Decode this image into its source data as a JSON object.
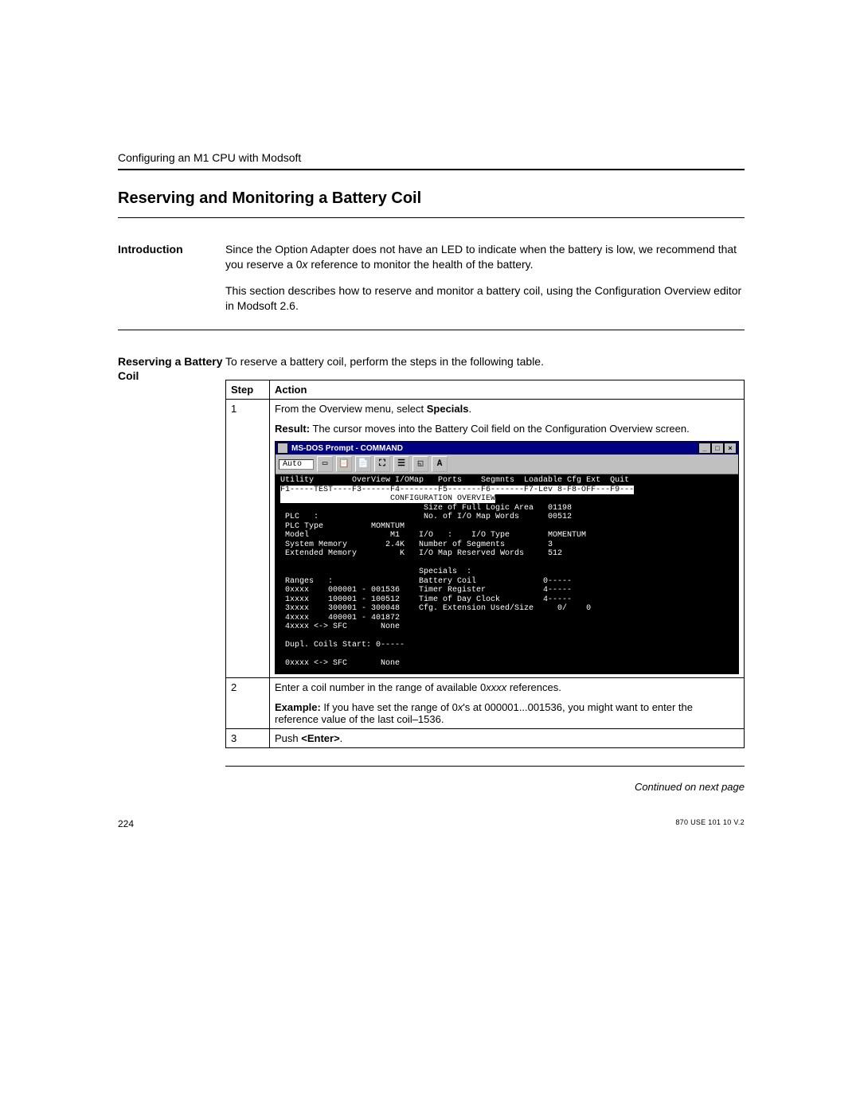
{
  "header": {
    "running": "Configuring an M1 CPU with Modsoft"
  },
  "title": "Reserving and Monitoring a Battery Coil",
  "intro": {
    "label": "Introduction",
    "p1a": "Since the Option Adapter does not have an LED to indicate when the battery is low, we recommend that you reserve a 0",
    "p1b": "x",
    "p1c": " reference to monitor the health of the battery.",
    "p2": "This section describes how to reserve and monitor a battery coil, using the Configuration Overview editor in Modsoft 2.6."
  },
  "reserve": {
    "label": "Reserving a Battery Coil",
    "lead": "To reserve a battery coil, perform the steps in the following table.",
    "table": {
      "h1": "Step",
      "h2": "Action",
      "rows": [
        {
          "step": "1",
          "a1": "From the Overview menu, select ",
          "a1b": "Specials",
          "a1c": ".",
          "res_lbl": "Result:",
          "res": " The cursor moves into the Battery Coil field on the Configuration Overview screen."
        },
        {
          "step": "2",
          "a1": "Enter a coil number in the range of available 0",
          "a1i": "xxxx",
          "a1c": " references.",
          "ex_lbl": "Example:",
          "ex": " If you have set the range of 0",
          "ex_i": "x",
          "ex2": "'s at 000001...001536, you might want to enter the reference value of the last coil–1536."
        },
        {
          "step": "3",
          "a1": "Push ",
          "a1b": "<Enter>",
          "a1c": "."
        }
      ]
    }
  },
  "dos": {
    "title": "MS-DOS Prompt - COMMAND",
    "dropdown": "Auto",
    "font_btn": "A",
    "menu": "Utility        OverView I/OMap   Ports    Segmnts  Loadable Cfg Ext  Quit",
    "fkeys": "F1-----TEST----F3------F4--------F5-------F6-------F7-Lev 8-F8-OFF---F9---",
    "hdr": "                       CONFIGURATION OVERVIEW",
    "l1": "                              Size of Full Logic Area   01198",
    "l2": " PLC   :                      No. of I/O Map Words      00512",
    "l3": " PLC Type          MOMNTUM",
    "l4": " Model                 M1    I/O   :    I/O Type        MOMENTUM",
    "l5": " System Memory        2.4K   Number of Segments         3",
    "l6": " Extended Memory         K   I/O Map Reserved Words     512",
    "l7": "",
    "l8": "                             Specials  :",
    "l9": " Ranges   :                  Battery Coil              0-----",
    "l10": " 0xxxx    000001 - 001536    Timer Register            4-----",
    "l11": " 1xxxx    100001 - 100512    Time of Day Clock         4-----",
    "l12": " 3xxxx    300001 - 300048    Cfg. Extension Used/Size     0/    0",
    "l13": " 4xxxx    400001 - 401872",
    "l14": " 4xxxx <-> SFC       None",
    "l15": "",
    "l16": " Dupl. Coils Start: 0-----",
    "l17": "",
    "l18": " 0xxxx <-> SFC       None"
  },
  "continued": "Continued on next page",
  "footer": {
    "page": "224",
    "docref": "870 USE 101 10 V.2"
  }
}
